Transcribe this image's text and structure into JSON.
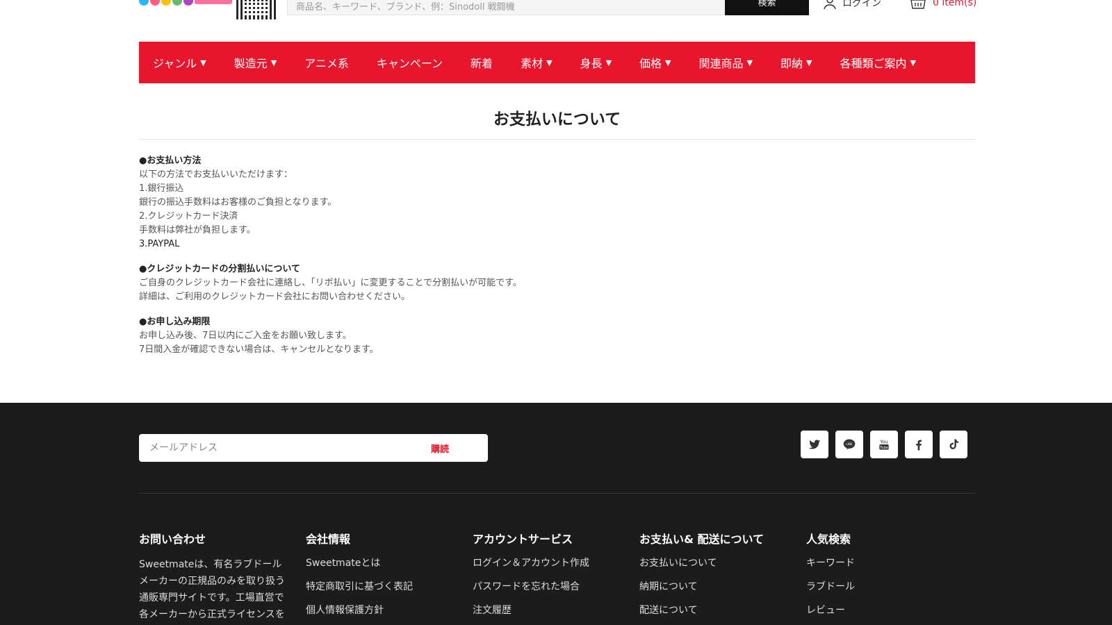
{
  "header": {
    "search_placeholder": "商品名、キーワード、ブランド、例：Sinodoll 戦闘機",
    "search_button": "検索",
    "login_label": "ログイン",
    "cart_label": "0 item(s)",
    "logo_colors": [
      "#29b6f6",
      "#ff5c8a",
      "#ffc107",
      "#66bb6a",
      "#ab47bc"
    ]
  },
  "nav": {
    "items": [
      {
        "label": "ジャンル",
        "has_dropdown": true
      },
      {
        "label": "製造元",
        "has_dropdown": true
      },
      {
        "label": "アニメ系",
        "has_dropdown": false
      },
      {
        "label": "キャンペーン",
        "has_dropdown": false
      },
      {
        "label": "新着",
        "has_dropdown": false
      },
      {
        "label": "素材",
        "has_dropdown": true
      },
      {
        "label": "身長",
        "has_dropdown": true
      },
      {
        "label": "価格",
        "has_dropdown": true
      },
      {
        "label": "関連商品",
        "has_dropdown": true
      },
      {
        "label": "即納",
        "has_dropdown": true
      },
      {
        "label": "各種類ご案内",
        "has_dropdown": true
      }
    ],
    "caret": "▼"
  },
  "main": {
    "title": "お支払いについて",
    "sections": [
      {
        "heading": "●お支払い方法",
        "lines": [
          {
            "text": "以下の方法でお支払いいただけます：",
            "dark": false
          },
          {
            "text": "1.銀行振込",
            "dark": false
          },
          {
            "text": "銀行の振込手数料はお客様のご負担となります。",
            "dark": false
          },
          {
            "text": "2.クレジットカード決済",
            "dark": false
          },
          {
            "text": "手数料は弊社が負担します。",
            "dark": false
          },
          {
            "text": "3.PAYPAL",
            "dark": true
          }
        ]
      },
      {
        "heading": "●クレジットカードの分割払いについて",
        "lines": [
          {
            "text": "ご自身のクレジットカード会社に連絡し、「リボ払い」に変更することで分割払いが可能です。",
            "dark": false
          },
          {
            "text": "詳細は、ご利用のクレジットカード会社にお問い合わせください。",
            "dark": false
          }
        ]
      },
      {
        "heading": "●お申し込み期限",
        "lines": [
          {
            "text": "お申し込み後、7日以内にご入金をお願い致します。",
            "dark": false
          },
          {
            "text": "7日間入金が確認できない場合は、キャンセルとなります。",
            "dark": false
          }
        ]
      }
    ]
  },
  "footer": {
    "email_placeholder": "メールアドレス",
    "subscribe_button": "購読",
    "socials": [
      "twitter-icon",
      "line-icon",
      "youtube-icon",
      "facebook-icon",
      "tiktok-icon"
    ],
    "columns": [
      {
        "title": "お問い合わせ",
        "text": "Sweetmateは、有名ラブドールメーカーの正規品のみを取り扱う通販専門サイトです。工場直営で各メーカーから正式ライセンスを取得した正規代理店として、商品質",
        "links": []
      },
      {
        "title": "会社情報",
        "links": [
          "Sweetmateとは",
          "特定商取引に基づく表記",
          "個人情報保護方針"
        ]
      },
      {
        "title": "アカウントサービス",
        "links": [
          "ログイン＆アカウント作成",
          "パスワードを忘れた場合",
          "注文履歴"
        ]
      },
      {
        "title": "お支払い& 配送について",
        "links": [
          "お支払いについて",
          "納期について",
          "配送について"
        ]
      },
      {
        "title": "人気検索",
        "links": [
          "キーワード",
          "ラブドール",
          "レビュー"
        ]
      }
    ]
  },
  "colors": {
    "accent": "#e8162d",
    "footer_bg": "#1c1c1c"
  }
}
